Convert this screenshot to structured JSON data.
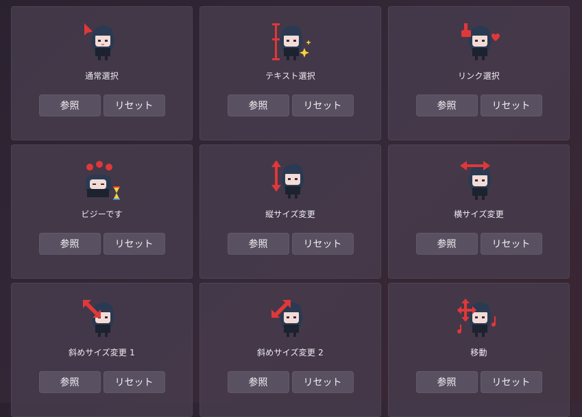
{
  "cursors": [
    {
      "label": "通常選択",
      "browse_label": "参照",
      "reset_label": "リセット",
      "icon": "arrow-pointer-icon"
    },
    {
      "label": "テキスト選択",
      "browse_label": "参照",
      "reset_label": "リセット",
      "icon": "text-beam-icon"
    },
    {
      "label": "リンク選択",
      "browse_label": "参照",
      "reset_label": "リセット",
      "icon": "hand-pointer-icon"
    },
    {
      "label": "ビジーです",
      "browse_label": "参照",
      "reset_label": "リセット",
      "icon": "busy-zzz-icon"
    },
    {
      "label": "縦サイズ変更",
      "browse_label": "参照",
      "reset_label": "リセット",
      "icon": "resize-vertical-icon"
    },
    {
      "label": "横サイズ変更",
      "browse_label": "参照",
      "reset_label": "リセット",
      "icon": "resize-horizontal-icon"
    },
    {
      "label": "斜めサイズ変更 1",
      "browse_label": "参照",
      "reset_label": "リセット",
      "icon": "resize-diagonal-1-icon"
    },
    {
      "label": "斜めサイズ変更 2",
      "browse_label": "参照",
      "reset_label": "リセット",
      "icon": "resize-diagonal-2-icon"
    },
    {
      "label": "移動",
      "browse_label": "参照",
      "reset_label": "リセット",
      "icon": "move-icon"
    }
  ],
  "colors": {
    "accent_red": "#e0383a",
    "hair": "#2a3a52",
    "skin": "#f4dcd6",
    "outfit": "#1c2230",
    "sparkle": "#f5d23c"
  }
}
